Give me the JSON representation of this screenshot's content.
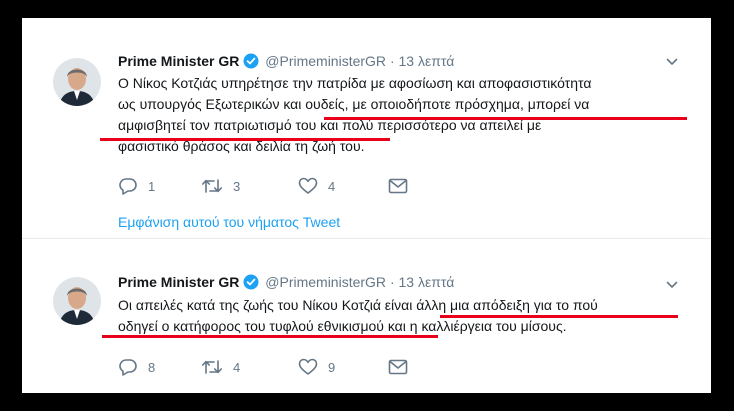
{
  "tweets": [
    {
      "name": "Prime Minister GR",
      "handle": "@PrimeministerGR",
      "separator": "·",
      "time": "13 λεπτά",
      "lines": [
        "Ο Νίκος Κοτζιάς υπηρέτησε την πατρίδα με αφοσίωση και αποφασιστικότητα",
        "ως υπουργός Εξωτερικών και ουδείς, με οποιοδήποτε πρόσχημα, μπορεί να",
        "αμφισβητεί τον πατριωτισμό του και πολύ περισσότερο να απειλεί με",
        "φασιστικό θράσος και δειλία τη ζωή του."
      ],
      "replies": "1",
      "retweets": "3",
      "likes": "4",
      "show_thread": "Εμφάνιση αυτού του νήματος Tweet"
    },
    {
      "name": "Prime Minister GR",
      "handle": "@PrimeministerGR",
      "separator": "·",
      "time": "13 λεπτά",
      "lines": [
        "Οι απειλές κατά της ζωής του Νίκου Κοτζιά είναι άλλη μια απόδειξη για το πού",
        "οδηγεί ο κατήφορος του τυφλού εθνικισμού και η καλλιέργεια του μίσους."
      ],
      "replies": "8",
      "retweets": "4",
      "likes": "9"
    }
  ],
  "colors": {
    "accent": "#1da1f2",
    "highlight": "#e8001a",
    "verified": "#1da1f2",
    "secondary_text": "#657786"
  }
}
